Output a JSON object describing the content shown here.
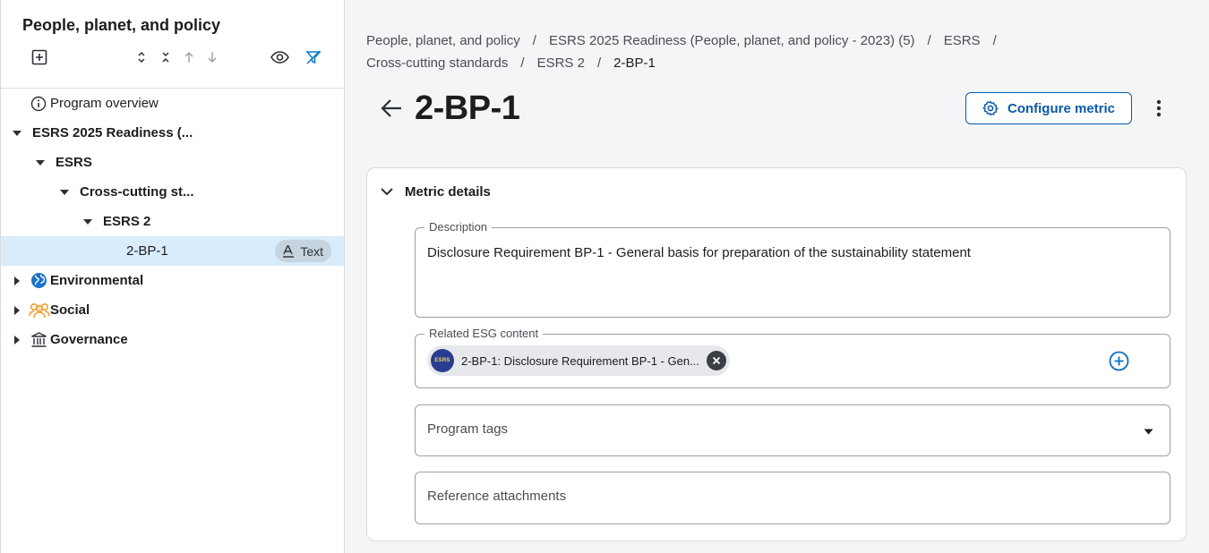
{
  "sidebar": {
    "title": "People, planet, and policy",
    "toolbar": {
      "add_icon": "add-box-icon",
      "expand_icon": "expand-all-icon",
      "collapse_icon": "collapse-all-icon",
      "move_up_icon": "arrow-up-icon",
      "move_down_icon": "arrow-down-icon",
      "view_icon": "eye-icon",
      "filter_icon": "filter-off-icon"
    },
    "tree": [
      {
        "label": "Program overview",
        "icon": "info-icon",
        "expanded": null
      },
      {
        "label": "ESRS 2025 Readiness (...",
        "expanded": true
      },
      {
        "label": "ESRS",
        "expanded": true
      },
      {
        "label": "Cross-cutting st...",
        "expanded": true
      },
      {
        "label": "ESRS 2",
        "expanded": true
      },
      {
        "label": "2-BP-1",
        "badge": "Text",
        "badge_icon": "text-format-icon",
        "selected": true
      },
      {
        "label": "Environmental",
        "icon": "globe-icon",
        "expanded": false
      },
      {
        "label": "Social",
        "icon": "people-icon",
        "expanded": false
      },
      {
        "label": "Governance",
        "icon": "institution-icon",
        "expanded": false
      }
    ]
  },
  "breadcrumb": [
    "People, planet, and policy",
    "ESRS 2025 Readiness (People, planet, and policy - 2023) (5)",
    "ESRS",
    "Cross-cutting standards",
    "ESRS 2",
    "2-BP-1"
  ],
  "breadcrumb_separator": "/",
  "header": {
    "title": "2-BP-1",
    "configure_label": "Configure metric"
  },
  "card": {
    "title": "Metric details",
    "description": {
      "label": "Description",
      "value": "Disclosure Requirement BP-1 - General basis for preparation of the sustainability statement"
    },
    "related": {
      "label": "Related ESG content",
      "chip_logo": "ESRS",
      "chip_text": "2-BP-1: Disclosure Requirement BP-1 - Gen..."
    },
    "program_tags": {
      "placeholder": "Program tags"
    },
    "attachments": {
      "placeholder": "Reference attachments"
    }
  },
  "colors": {
    "accent": "#0a5aa8",
    "selected_row": "#d8ecfb",
    "globe": "#1a73c9",
    "social": "#f0a030"
  }
}
